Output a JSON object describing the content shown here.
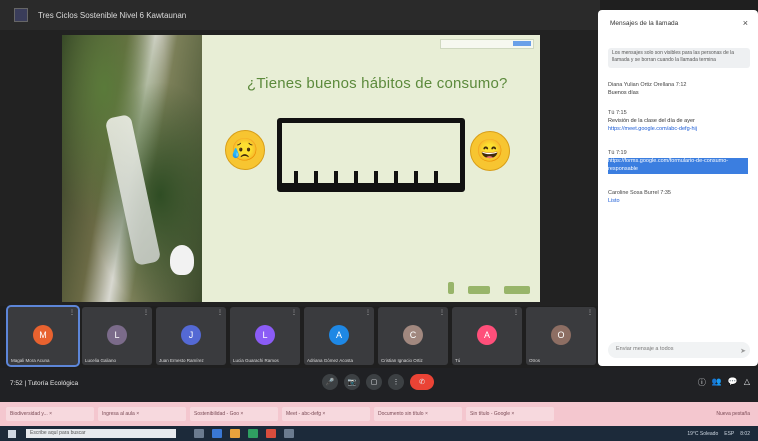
{
  "window": {
    "title": "Tres Ciclos Sostenible Nivel 6 Kawtaunan"
  },
  "slide": {
    "title": "¿Tienes buenos hábitos de consumo?",
    "sad_emoji": "😥",
    "happy_emoji": "😄",
    "ruler_ticks": 8
  },
  "panel": {
    "header": "Mensajes de la llamada",
    "close_icon": "×",
    "note": "Los mensajes solo son visibles para las personas de la llamada y se borran cuando la llamada termina",
    "messages": [
      {
        "who": "Diana Yulian Ortiz Orellana 7:12",
        "text": "Buenos días"
      },
      {
        "who": "Tú 7:15",
        "text": "Revisión de la clase del día de ayer",
        "link": "https://meet.google.com/abc-defg-hij"
      },
      {
        "who": "Tú 7:19",
        "text": "https://forms.google.com/formulario-de-consumo-responsable",
        "highlight": true
      },
      {
        "who": "Caroline Sosa Burrel 7:35",
        "text": "Listo"
      }
    ],
    "input_placeholder": "Enviar mensaje a todos",
    "send_icon": "➤"
  },
  "tiles": [
    {
      "name": "Magali Mora Acuna",
      "initial": "M",
      "color": "#e8622f",
      "active": true
    },
    {
      "name": "Lucelia Galiano",
      "initial": "L",
      "color": "#7b6b8a"
    },
    {
      "name": "Juan Ernesto Ramírez",
      "initial": "J",
      "color": "#5469d4"
    },
    {
      "name": "Lucia Guarachi Ramos",
      "initial": "L",
      "color": "#8b5cf6"
    },
    {
      "name": "Adriana Gómez Acosta",
      "initial": "A",
      "color": "#1e88e5"
    },
    {
      "name": "Cristian Ignacio Ortiz",
      "initial": "C",
      "color": "#a1887f"
    },
    {
      "name": "Tú",
      "initial": "A",
      "color": "#ff4f7a"
    },
    {
      "name": "Otros",
      "initial": "O",
      "color": "#8d6e63"
    }
  ],
  "bottombar": {
    "time_label": "7:52 | Tutoría Ecológica",
    "buttons": [
      "🎤",
      "📷",
      "▢",
      "⋮",
      "✆"
    ],
    "right_icons": [
      "ⓘ",
      "👥",
      "💬",
      "△"
    ]
  },
  "browser_tabs": [
    "Biodiversidad y... ×",
    "Ingresa al aula ×",
    "Sostenibilidad - Goo ×",
    "Meet - abc-defg ×",
    "Documento sin título ×",
    "Sin título - Google ×"
  ],
  "browser_tabs_right": "Nueva pestaña",
  "taskbar": {
    "search_placeholder": "Escribe aquí para buscar",
    "tray_text": [
      "19°C Soleado",
      "ESP",
      "8:02"
    ]
  }
}
